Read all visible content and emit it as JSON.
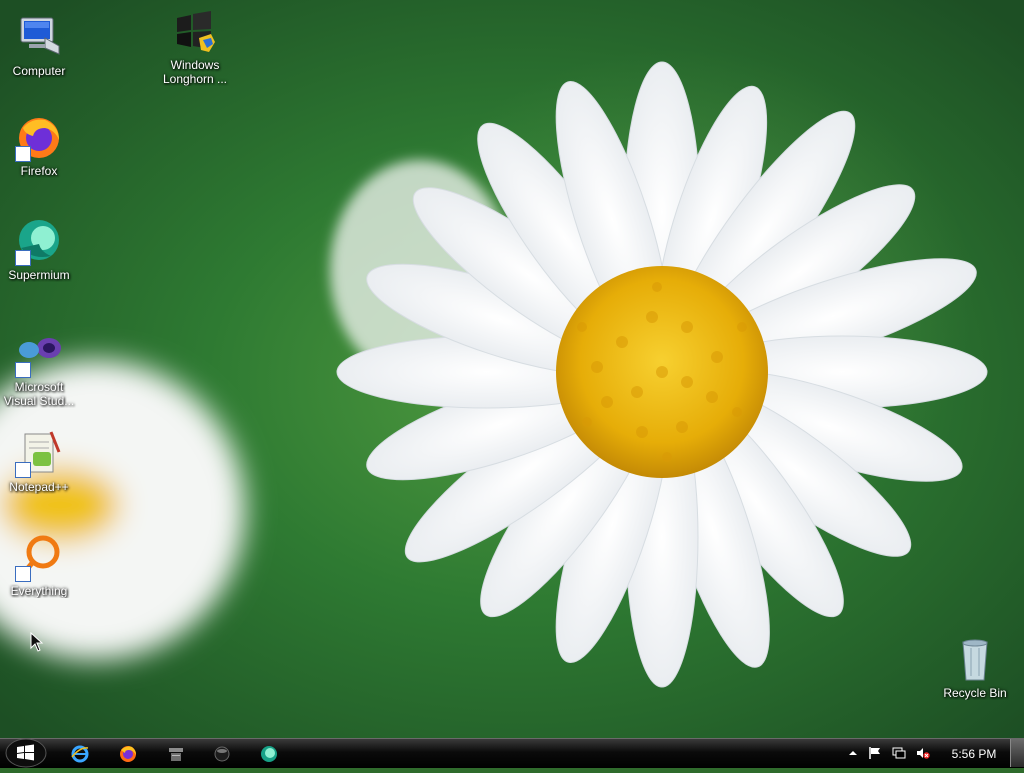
{
  "desktop_icons": [
    {
      "label": "Computer",
      "icon": "computer-icon"
    },
    {
      "label": "Windows\nLonghorn ...",
      "icon": "windows-flag-icon"
    },
    {
      "label": "Firefox",
      "icon": "firefox-icon"
    },
    {
      "label": "Supermium",
      "icon": "supermium-icon"
    },
    {
      "label": "Microsoft\nVisual Stud...",
      "icon": "visual-studio-icon"
    },
    {
      "label": "Notepad++",
      "icon": "notepad-plus-plus-icon"
    },
    {
      "label": "Everything",
      "icon": "everything-search-icon"
    },
    {
      "label": "Recycle Bin",
      "icon": "recycle-bin-icon"
    }
  ],
  "taskbar": {
    "start_icon": "windows-orb-icon",
    "quick_launch": [
      "internet-explorer-icon",
      "firefox-icon",
      "server-icon",
      "media-player-icon",
      "supermium-icon"
    ],
    "tray": [
      "show-hidden-icons-arrow",
      "action-center-flag-icon",
      "network-icon",
      "volume-muted-icon"
    ],
    "clock": "5:56 PM"
  },
  "colors": {
    "taskbar": "#000000",
    "wallpaper_green": "#3a8a36",
    "flower_center": "#e8b40c"
  }
}
